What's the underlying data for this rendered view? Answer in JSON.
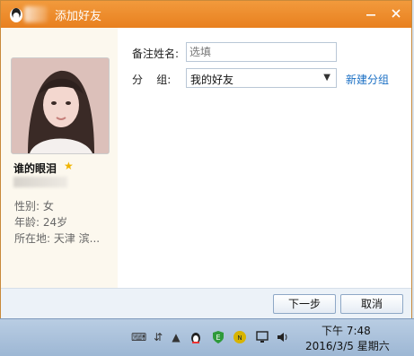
{
  "window": {
    "title": "添加好友"
  },
  "profile": {
    "nickname": "谁的眼泪",
    "gender": "性别: 女",
    "age": "年龄: 24岁",
    "location": "所在地: 天津  滨..."
  },
  "form": {
    "remark_label": "备注姓名:",
    "remark_placeholder": "选填",
    "group_label": "分    组:",
    "group_value": "我的好友",
    "new_group_link": "新建分组"
  },
  "buttons": {
    "next": "下一步",
    "cancel": "取消"
  },
  "taskbar": {
    "time": "下午 7:48",
    "date": "2016/3/5 星期六"
  },
  "colors": {
    "titlebar": "#ec8a2a",
    "link": "#1a6fc4",
    "left_panel": "#fcf8ee"
  }
}
